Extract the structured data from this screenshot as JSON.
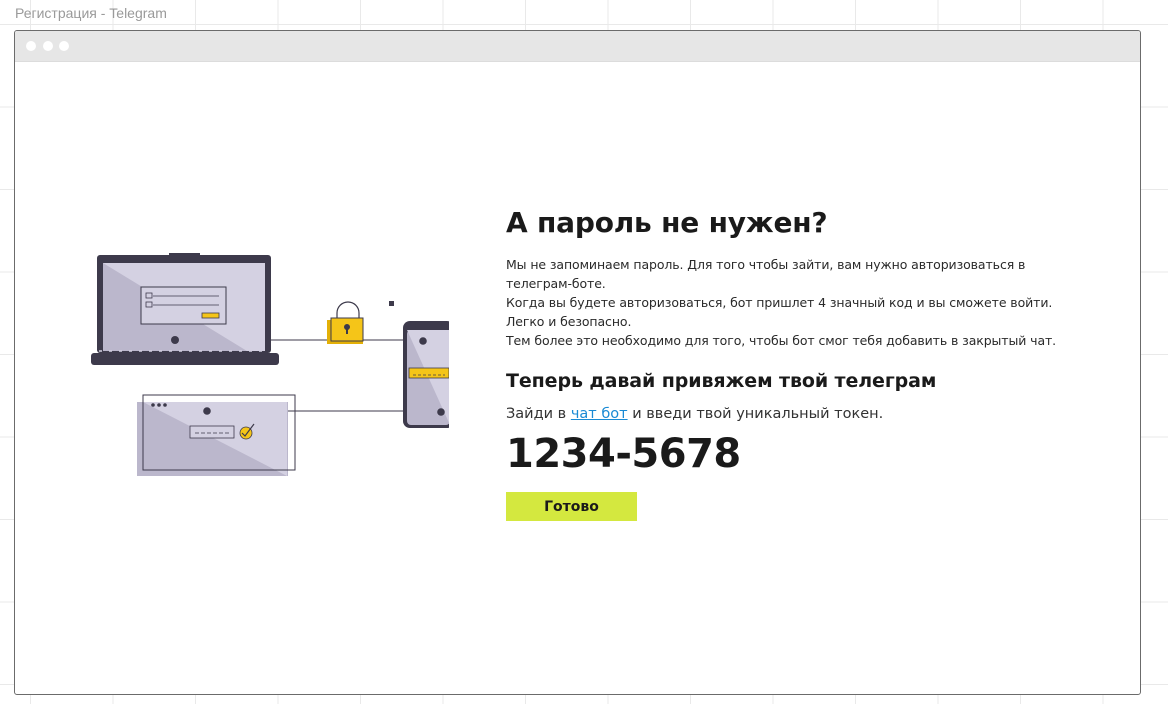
{
  "window": {
    "frame_title": "Регистрация - Telegram"
  },
  "main": {
    "title": "А пароль не нужен?",
    "description_lines": [
      "Мы не запоминаем пароль. Для того чтобы зайти, вам нужно авторизоваться в",
      "телеграм-боте.",
      "Когда вы будете авторизоваться, бот пришлет 4 значный код и вы сможете войти.",
      "Легко и безопасно.",
      "Тем более это необходимо для того, чтобы бот смог тебя добавить в закрытый чат."
    ],
    "subtitle": "Теперь давай привяжем твой телеграм",
    "instruction_before": "Зайди в ",
    "bot_link_text": "чат бот",
    "instruction_after": " и введи твой уникальный токен.",
    "token": "1234-5678",
    "ready_button": "Готово"
  },
  "colors": {
    "accent": "#d4e83f",
    "link": "#1a8ad4",
    "lock": "#f5c518",
    "device_dark": "#3d3a4b",
    "screen_light": "#d4d1e2",
    "screen_shade": "#bbb7cc"
  },
  "icons": {
    "window_controls": "traffic-light-dots",
    "illustration": "laptop-phone-lock-browser-illustration"
  }
}
